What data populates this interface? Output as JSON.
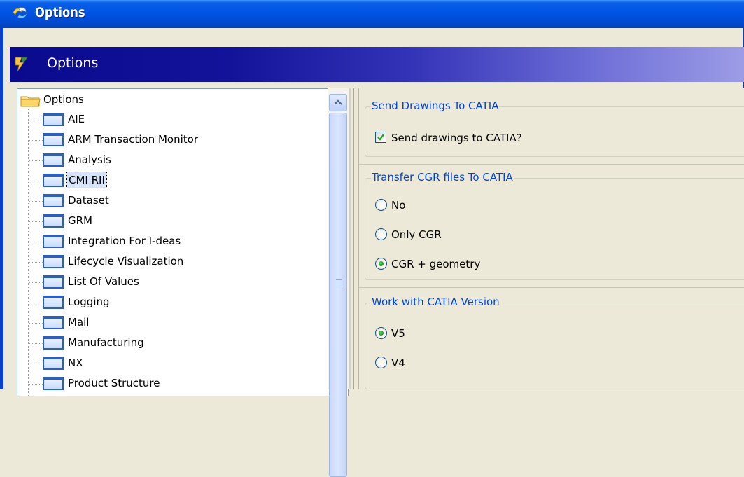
{
  "window": {
    "title": "Options"
  },
  "banner": {
    "title": "Options"
  },
  "tree": {
    "root_label": "Options",
    "items": [
      {
        "label": "AIE"
      },
      {
        "label": "ARM Transaction Monitor"
      },
      {
        "label": "Analysis"
      },
      {
        "label": "CMI RII",
        "selected": true
      },
      {
        "label": "Dataset"
      },
      {
        "label": "GRM"
      },
      {
        "label": "Integration For I-deas"
      },
      {
        "label": "Lifecycle Visualization"
      },
      {
        "label": "List Of Values"
      },
      {
        "label": "Logging"
      },
      {
        "label": "Mail"
      },
      {
        "label": "Manufacturing"
      },
      {
        "label": "NX"
      },
      {
        "label": "Product Structure"
      }
    ]
  },
  "send_drawings": {
    "legend": "Send Drawings To CATIA",
    "checkbox_label": "Send drawings to CATIA?",
    "checked": true
  },
  "transfer_cgr": {
    "legend": "Transfer CGR files To CATIA",
    "options": [
      {
        "label": "No",
        "selected": false
      },
      {
        "label": "Only CGR",
        "selected": false
      },
      {
        "label": "CGR + geometry",
        "selected": true
      }
    ]
  },
  "catia_version": {
    "legend": "Work with CATIA Version",
    "options": [
      {
        "label": "V5",
        "selected": true
      },
      {
        "label": "V4",
        "selected": false
      }
    ]
  },
  "colors": {
    "title_bar": "#0054e3",
    "banner_start": "#0a0a8f",
    "banner_end": "#9c9ce6",
    "legend_text": "#0046d5",
    "radio_dot": "#21a121"
  }
}
